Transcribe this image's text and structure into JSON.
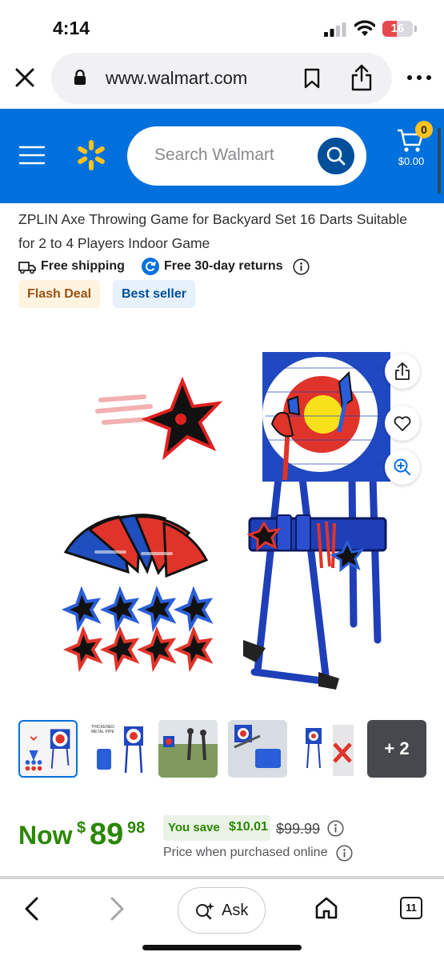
{
  "status": {
    "time": "4:14",
    "battery": "16"
  },
  "browser": {
    "url": "www.walmart.com",
    "tabs_count": "11"
  },
  "header": {
    "search_placeholder": "Search Walmart",
    "cart_count": "0",
    "cart_total": "$0.00"
  },
  "product": {
    "title": "ZPLIN Axe Throwing Game for Backyard Set 16 Darts Suitable for 2 to 4 Players Indoor Game",
    "shipping": "Free shipping",
    "returns": "Free 30-day returns",
    "badges": [
      "Flash Deal",
      "Best seller"
    ],
    "thumb_more": "+ 2",
    "thumb_captions": [
      "THICKENED METAL PIPE"
    ]
  },
  "price": {
    "now_label": "Now",
    "currency": "$",
    "whole": "89",
    "cents": "98",
    "save_label": "You save",
    "save_amount": "$10.01",
    "was": "$99.99",
    "online_note": "Price when purchased online"
  },
  "toolbar": {
    "ask_label": "Ask"
  },
  "colors": {
    "brand_blue": "#0071dc",
    "spark_yellow": "#ffc220",
    "price_green": "#2a8703"
  }
}
